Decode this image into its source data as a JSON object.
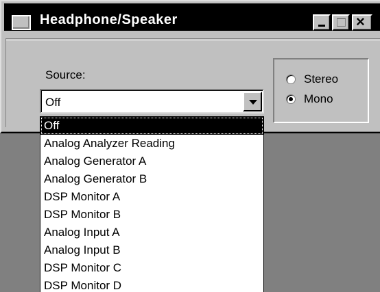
{
  "window": {
    "title": "Headphone/Speaker",
    "close_glyph": "×"
  },
  "source": {
    "label": "Source:",
    "selected": "Off",
    "options": [
      "Off",
      "Analog Analyzer Reading",
      "Analog Generator A",
      "Analog Generator B",
      "DSP Monitor A",
      "DSP Monitor B",
      "Analog Input A",
      "Analog Input B",
      "DSP Monitor C",
      "DSP Monitor D"
    ]
  },
  "mode": {
    "stereo_label": "Stereo",
    "mono_label": "Mono",
    "selected": "Mono"
  },
  "colors": {
    "window_bg": "#c0c0c0",
    "desktop_bg": "#808080",
    "titlebar_bg": "#000000",
    "highlight": "#000000"
  },
  "icons": {
    "app": "window-icon",
    "minimize": "minimize-icon",
    "maximize": "maximize-icon",
    "close": "close-icon",
    "dropdown": "chevron-down-icon"
  }
}
